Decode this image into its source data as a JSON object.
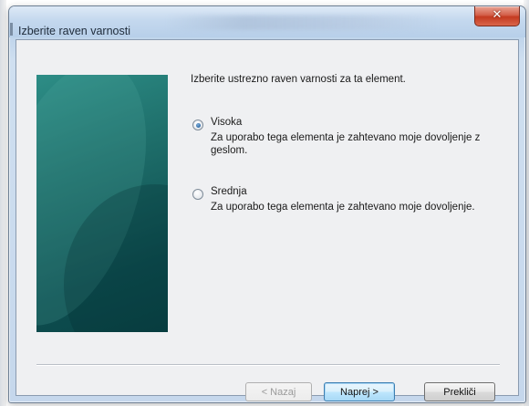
{
  "window": {
    "title": "Izberite raven varnosti",
    "close_glyph": "✕"
  },
  "content": {
    "prompt": "Izberite ustrezno raven varnosti za ta element.",
    "options": [
      {
        "label": "Visoka",
        "description": "Za uporabo tega elementa je zahtevano moje dovoljenje z geslom.",
        "selected": true
      },
      {
        "label": "Srednja",
        "description": "Za uporabo tega elementa je zahtevano moje dovoljenje.",
        "selected": false
      }
    ]
  },
  "buttons": {
    "back": "< Nazaj",
    "next": "Naprej >",
    "cancel": "Prekliči"
  },
  "colors": {
    "side_panel": "#1e6e6a",
    "close_button": "#c43a20",
    "default_button_border": "#3c7fb1"
  },
  "icons": {
    "close": "close-icon",
    "radio_selected": "radio-checked",
    "radio_unselected": "radio-unchecked"
  }
}
